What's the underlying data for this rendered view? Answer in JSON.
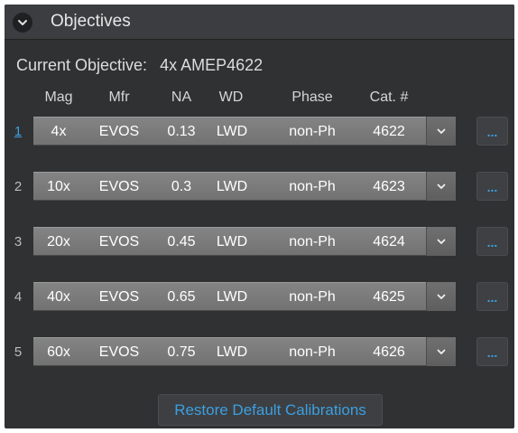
{
  "header": {
    "title": "Objectives",
    "toggle_icon": "chevron-down-icon"
  },
  "current_objective": {
    "label": "Current Objective:",
    "value": "4x AMEP4622"
  },
  "columns": [
    "Mag",
    "Mfr",
    "NA",
    "WD",
    "Phase",
    "Cat. #"
  ],
  "rows": [
    {
      "index": "1",
      "mag": "4x",
      "mfr": "EVOS",
      "na": "0.13",
      "wd": "LWD",
      "phase": "non-Ph",
      "cat": "4622",
      "active": true
    },
    {
      "index": "2",
      "mag": "10x",
      "mfr": "EVOS",
      "na": "0.3",
      "wd": "LWD",
      "phase": "non-Ph",
      "cat": "4623",
      "active": false
    },
    {
      "index": "3",
      "mag": "20x",
      "mfr": "EVOS",
      "na": "0.45",
      "wd": "LWD",
      "phase": "non-Ph",
      "cat": "4624",
      "active": false
    },
    {
      "index": "4",
      "mag": "40x",
      "mfr": "EVOS",
      "na": "0.65",
      "wd": "LWD",
      "phase": "non-Ph",
      "cat": "4625",
      "active": false
    },
    {
      "index": "5",
      "mag": "60x",
      "mfr": "EVOS",
      "na": "0.75",
      "wd": "LWD",
      "phase": "non-Ph",
      "cat": "4626",
      "active": false
    }
  ],
  "more_button_label": "...",
  "restore_button": {
    "label": "Restore Default Calibrations"
  },
  "colors": {
    "accent": "#3d9fe0",
    "panel": "#2f3133",
    "row": "#7b7b7b"
  }
}
